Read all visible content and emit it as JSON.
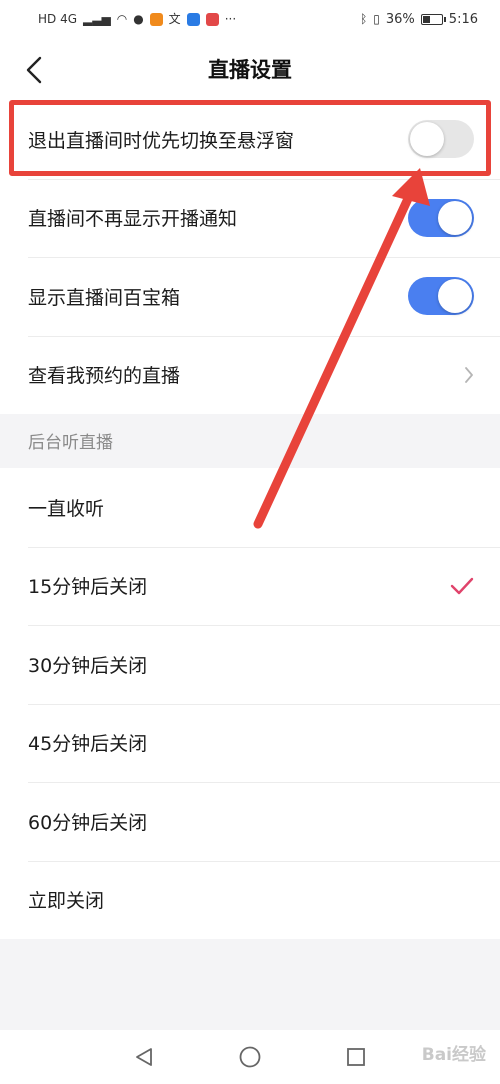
{
  "status_bar": {
    "network": "HD 4G",
    "more": "···",
    "battery_percent_label": "36%",
    "battery_level": 0.36,
    "time": "5:16"
  },
  "header": {
    "title": "直播设置",
    "back_icon": "chevron-left-icon"
  },
  "settings": [
    {
      "label": "退出直播间时优先切换至悬浮窗",
      "control": "toggle",
      "on": false
    },
    {
      "label": "直播间不再显示开播通知",
      "control": "toggle",
      "on": true
    },
    {
      "label": "显示直播间百宝箱",
      "control": "toggle",
      "on": true
    },
    {
      "label": "查看我预约的直播",
      "control": "chevron",
      "icon": "chevron-right-icon"
    }
  ],
  "background_listening": {
    "header": "后台听直播",
    "options": [
      {
        "label": "一直收听",
        "selected": false
      },
      {
        "label": "15分钟后关闭",
        "selected": true
      },
      {
        "label": "30分钟后关闭",
        "selected": false
      },
      {
        "label": "45分钟后关闭",
        "selected": false
      },
      {
        "label": "60分钟后关闭",
        "selected": false
      },
      {
        "label": "立即关闭",
        "selected": false
      }
    ],
    "check_icon": "checkmark-icon"
  },
  "colors": {
    "toggle_on": "#4a7ff0",
    "toggle_off": "#e6e6e6",
    "check": "#e0436b",
    "annotation": "#e8433a"
  },
  "nav_bar": {
    "icons": [
      "back-triangle-icon",
      "home-circle-icon",
      "recents-square-icon"
    ]
  },
  "watermark": "Bai经验"
}
